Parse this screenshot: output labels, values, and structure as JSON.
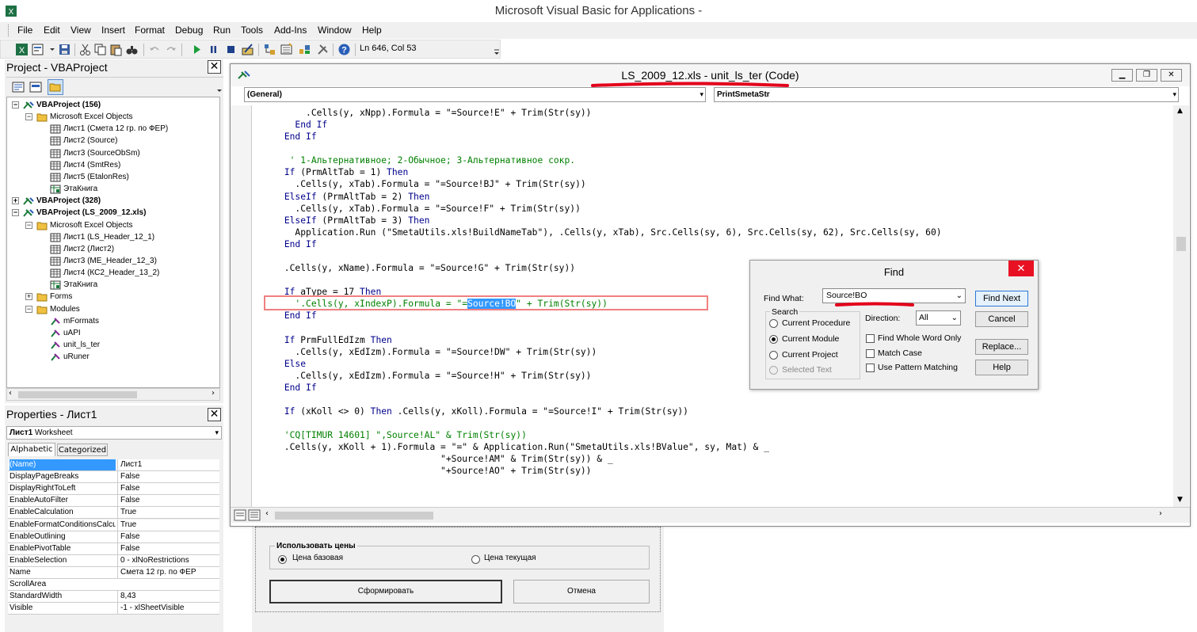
{
  "window": {
    "title": "Microsoft Visual Basic for Applications -"
  },
  "menu": [
    "File",
    "Edit",
    "View",
    "Insert",
    "Format",
    "Debug",
    "Run",
    "Tools",
    "Add-Ins",
    "Window",
    "Help"
  ],
  "toolbar": {
    "position": "Ln 646, Col 53"
  },
  "project": {
    "title": "Project - VBAProject",
    "close": "✕",
    "tree": [
      {
        "label": "VBAProject (156)",
        "bold": true,
        "indent": 0,
        "icon": "vbaproject-icon",
        "toggle": "−"
      },
      {
        "label": "Microsoft Excel Objects",
        "indent": 1,
        "icon": "folder-icon",
        "toggle": "−"
      },
      {
        "label": "Лист1 (Смета 12 гр. по ФЕР)",
        "indent": 2,
        "icon": "sheet-icon"
      },
      {
        "label": "Лист2 (Source)",
        "indent": 2,
        "icon": "sheet-icon"
      },
      {
        "label": "Лист3 (SourceObSm)",
        "indent": 2,
        "icon": "sheet-icon"
      },
      {
        "label": "Лист4 (SmtRes)",
        "indent": 2,
        "icon": "sheet-icon"
      },
      {
        "label": "Лист5 (EtalonRes)",
        "indent": 2,
        "icon": "sheet-icon"
      },
      {
        "label": "ЭтаКнига",
        "indent": 2,
        "icon": "workbook-icon"
      },
      {
        "label": "VBAProject (328)",
        "bold": true,
        "indent": 0,
        "icon": "vbaproject-icon",
        "toggle": "+"
      },
      {
        "label": "VBAProject (LS_2009_12.xls)",
        "bold": true,
        "indent": 0,
        "icon": "vbaproject-icon",
        "toggle": "−"
      },
      {
        "label": "Microsoft Excel Objects",
        "indent": 1,
        "icon": "folder-icon",
        "toggle": "−"
      },
      {
        "label": "Лист1 (LS_Header_12_1)",
        "indent": 2,
        "icon": "sheet-icon"
      },
      {
        "label": "Лист2 (Лист2)",
        "indent": 2,
        "icon": "sheet-icon"
      },
      {
        "label": "Лист3 (ME_Header_12_3)",
        "indent": 2,
        "icon": "sheet-icon"
      },
      {
        "label": "Лист4 (КС2_Header_13_2)",
        "indent": 2,
        "icon": "sheet-icon"
      },
      {
        "label": "ЭтаКнига",
        "indent": 2,
        "icon": "workbook-icon"
      },
      {
        "label": "Forms",
        "indent": 1,
        "icon": "folder-icon",
        "toggle": "+"
      },
      {
        "label": "Modules",
        "indent": 1,
        "icon": "folder-icon",
        "toggle": "−"
      },
      {
        "label": "mFormats",
        "indent": 2,
        "icon": "module-icon"
      },
      {
        "label": "uAPI",
        "indent": 2,
        "icon": "module-icon"
      },
      {
        "label": "unit_ls_ter",
        "indent": 2,
        "icon": "module-icon"
      },
      {
        "label": "uRuner",
        "indent": 2,
        "icon": "module-icon"
      }
    ]
  },
  "properties": {
    "title": "Properties - Лист1",
    "close": "✕",
    "object_name": "Лист1",
    "object_type": "Worksheet",
    "tabs": [
      "Alphabetic",
      "Categorized"
    ],
    "rows": [
      {
        "k": "(Name)",
        "v": "Лист1"
      },
      {
        "k": "DisplayPageBreaks",
        "v": "False"
      },
      {
        "k": "DisplayRightToLeft",
        "v": "False"
      },
      {
        "k": "EnableAutoFilter",
        "v": "False"
      },
      {
        "k": "EnableCalculation",
        "v": "True"
      },
      {
        "k": "EnableFormatConditionsCalculation",
        "v": "True"
      },
      {
        "k": "EnableOutlining",
        "v": "False"
      },
      {
        "k": "EnablePivotTable",
        "v": "False"
      },
      {
        "k": "EnableSelection",
        "v": "0 - xlNoRestrictions"
      },
      {
        "k": "Name",
        "v": "Смета 12 гр. по ФЕР"
      },
      {
        "k": "ScrollArea",
        "v": ""
      },
      {
        "k": "StandardWidth",
        "v": "8,43"
      },
      {
        "k": "Visible",
        "v": "-1 - xlSheetVisible"
      }
    ]
  },
  "codewin": {
    "title": "LS_2009_12.xls - unit_ls_ter (Code)",
    "object_combo": "(General)",
    "proc_combo": "PrintSmetaStr",
    "lines": [
      [
        {
          "t": "          .Cells(y, xNpp).Formula = \"=Source!E\" + Trim(Str(sy))"
        }
      ],
      [
        {
          "t": "        ",
          "c": ""
        },
        {
          "t": "End If",
          "c": "kw"
        }
      ],
      [
        {
          "t": "      ",
          "c": ""
        },
        {
          "t": "End If",
          "c": "kw"
        }
      ],
      [
        {
          "t": ""
        }
      ],
      [
        {
          "t": "       ' 1-Альтернативное; 2-Обычное; 3-Альтернативное сокр.",
          "c": "cm"
        }
      ],
      [
        {
          "t": "      ",
          "c": ""
        },
        {
          "t": "If",
          "c": "kw"
        },
        {
          "t": " (PrmAltTab = 1) "
        },
        {
          "t": "Then",
          "c": "kw"
        }
      ],
      [
        {
          "t": "        .Cells(y, xTab).Formula = \"=Source!BJ\" + Trim(Str(sy))"
        }
      ],
      [
        {
          "t": "      ",
          "c": ""
        },
        {
          "t": "ElseIf",
          "c": "kw"
        },
        {
          "t": " (PrmAltTab = 2) "
        },
        {
          "t": "Then",
          "c": "kw"
        }
      ],
      [
        {
          "t": "        .Cells(y, xTab).Formula = \"=Source!F\" + Trim(Str(sy))"
        }
      ],
      [
        {
          "t": "      ",
          "c": ""
        },
        {
          "t": "ElseIf",
          "c": "kw"
        },
        {
          "t": " (PrmAltTab = 3) "
        },
        {
          "t": "Then",
          "c": "kw"
        }
      ],
      [
        {
          "t": "        Application.Run (\"SmetaUtils.xls!BuildNameTab\"), .Cells(y, xTab), Src.Cells(sy, 6), Src.Cells(sy, 62), Src.Cells(sy, 60)"
        }
      ],
      [
        {
          "t": "      ",
          "c": ""
        },
        {
          "t": "End If",
          "c": "kw"
        }
      ],
      [
        {
          "t": ""
        }
      ],
      [
        {
          "t": "      .Cells(y, xName).Formula = \"=Source!G\" + Trim(Str(sy))"
        }
      ],
      [
        {
          "t": ""
        }
      ],
      [
        {
          "t": "      ",
          "c": ""
        },
        {
          "t": "If",
          "c": "kw"
        },
        {
          "t": " aType = 17 "
        },
        {
          "t": "Then",
          "c": "kw"
        }
      ],
      [
        {
          "t": "        '.Cells(y, xIndexP).Formula = \"=",
          "c": "cm"
        },
        {
          "t": "Source!BO",
          "c": "hl"
        },
        {
          "t": "\" + Trim(Str(sy))",
          "c": "cm"
        }
      ],
      [
        {
          "t": "      ",
          "c": ""
        },
        {
          "t": "End If",
          "c": "kw"
        }
      ],
      [
        {
          "t": ""
        }
      ],
      [
        {
          "t": "      ",
          "c": ""
        },
        {
          "t": "If",
          "c": "kw"
        },
        {
          "t": " PrmFullEdIzm "
        },
        {
          "t": "Then",
          "c": "kw"
        }
      ],
      [
        {
          "t": "        .Cells(y, xEdIzm).Formula = \"=Source!DW\" + Trim(Str(sy))"
        }
      ],
      [
        {
          "t": "      ",
          "c": ""
        },
        {
          "t": "Else",
          "c": "kw"
        }
      ],
      [
        {
          "t": "        .Cells(y, xEdIzm).Formula = \"=Source!H\" + Trim(Str(sy))"
        }
      ],
      [
        {
          "t": "      ",
          "c": ""
        },
        {
          "t": "End If",
          "c": "kw"
        }
      ],
      [
        {
          "t": ""
        }
      ],
      [
        {
          "t": "      ",
          "c": ""
        },
        {
          "t": "If",
          "c": "kw"
        },
        {
          "t": " (xKoll <> 0) "
        },
        {
          "t": "Then",
          "c": "kw"
        },
        {
          "t": " .Cells(y, xKoll).Formula = \"=Source!I\" + Trim(Str(sy))"
        }
      ],
      [
        {
          "t": ""
        }
      ],
      [
        {
          "t": "      'CQ[TIMUR 14601] \",Source!AL\" & Trim(Str(sy))",
          "c": "cm"
        }
      ],
      [
        {
          "t": "      .Cells(y, xKoll + 1).Formula = \"=\" & Application.Run(\"SmetaUtils.xls!BValue\", sy, Mat) & _"
        }
      ],
      [
        {
          "t": "                                   \"+Source!AM\" & Trim(Str(sy)) & _"
        }
      ],
      [
        {
          "t": "                                   \"+Source!AO\" + Trim(Str(sy))"
        }
      ]
    ]
  },
  "find": {
    "title": "Find",
    "close": "✕",
    "find_what_label": "Find What:",
    "find_what_value": "Source!BO",
    "search_label": "Search",
    "direction_label": "Direction:",
    "direction_value": "All",
    "options": {
      "current_procedure": "Current Procedure",
      "current_module": "Current Module",
      "current_project": "Current Project",
      "selected_text": "Selected Text",
      "whole_word": "Find Whole Word Only",
      "match_case": "Match Case",
      "pattern": "Use Pattern Matching"
    },
    "buttons": {
      "find_next": "Find Next",
      "cancel": "Cancel",
      "replace": "Replace...",
      "help": "Help"
    }
  },
  "userform": {
    "group_label": "Использовать цены",
    "radio_base": "Цена базовая",
    "radio_current": "Цена текущая",
    "btn_generate": "Сформировать",
    "btn_cancel": "Отмена"
  },
  "colors": {
    "keyword": "#00008b",
    "comment": "#008000",
    "selection": "#3399ff",
    "annotation": "#e3001b",
    "highlight_box": "#f08080"
  }
}
